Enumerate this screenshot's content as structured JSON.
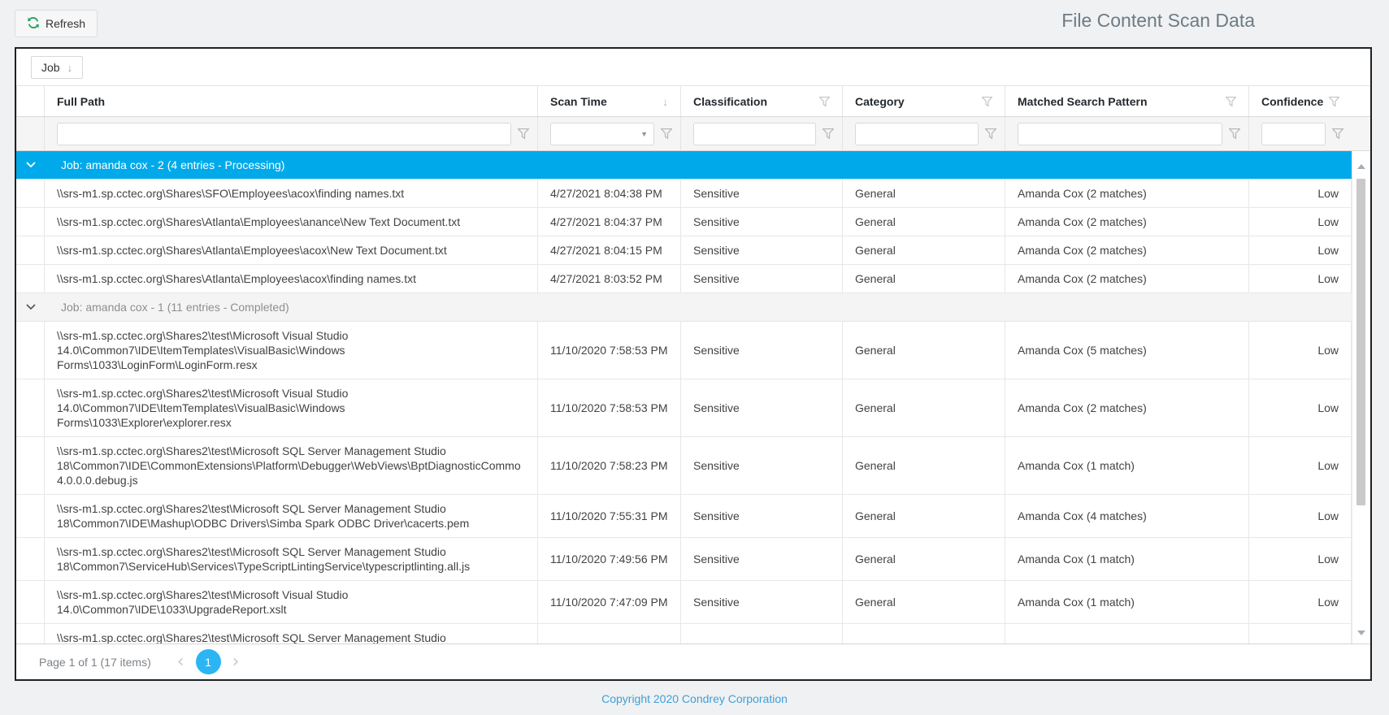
{
  "page": {
    "title": "File Content Scan Data",
    "footer_link": "Copyright 2020 Condrey Corporation"
  },
  "toolbar": {
    "refresh_label": "Refresh"
  },
  "group_panel": {
    "chip_label": "Job",
    "chip_sort_glyph": "↓"
  },
  "glyphs": {
    "sort_desc": "↓",
    "dropdown_caret": "▼",
    "prev": "‹",
    "next": "›"
  },
  "colors": {
    "selection_blue": "#00aaea",
    "pager_blue": "#2bb5f4",
    "refresh_green": "#27a163"
  },
  "columns": [
    {
      "label": "Full Path"
    },
    {
      "label": "Scan Time",
      "sort": "desc"
    },
    {
      "label": "Classification",
      "funnel": true
    },
    {
      "label": "Category",
      "funnel": true
    },
    {
      "label": "Matched Search Pattern",
      "funnel": true
    },
    {
      "label": "Confidence",
      "funnel": true
    }
  ],
  "filter_row": {
    "full_path_value": "",
    "scan_time_value": "",
    "classification_value": "",
    "category_value": "",
    "matched_value": "",
    "confidence_value": ""
  },
  "grid": {
    "groups": [
      {
        "label": "Job: amanda cox - 2 (4 entries - Processing)",
        "selected": true,
        "rows": [
          {
            "path_lines": [
              "\\\\srs-m1.sp.cctec.org\\Shares\\SFO\\Employees\\acox\\finding names.txt"
            ],
            "scan_time": "4/27/2021 8:04:38 PM",
            "classification": "Sensitive",
            "category": "General",
            "matched": "Amanda Cox (2 matches)",
            "confidence": "Low"
          },
          {
            "path_lines": [
              "\\\\srs-m1.sp.cctec.org\\Shares\\Atlanta\\Employees\\anance\\New Text Document.txt"
            ],
            "scan_time": "4/27/2021 8:04:37 PM",
            "classification": "Sensitive",
            "category": "General",
            "matched": "Amanda Cox (2 matches)",
            "confidence": "Low"
          },
          {
            "path_lines": [
              "\\\\srs-m1.sp.cctec.org\\Shares\\Atlanta\\Employees\\acox\\New Text Document.txt"
            ],
            "scan_time": "4/27/2021 8:04:15 PM",
            "classification": "Sensitive",
            "category": "General",
            "matched": "Amanda Cox (2 matches)",
            "confidence": "Low"
          },
          {
            "path_lines": [
              "\\\\srs-m1.sp.cctec.org\\Shares\\Atlanta\\Employees\\acox\\finding names.txt"
            ],
            "scan_time": "4/27/2021 8:03:52 PM",
            "classification": "Sensitive",
            "category": "General",
            "matched": "Amanda Cox (2 matches)",
            "confidence": "Low"
          }
        ]
      },
      {
        "label": "Job: amanda cox - 1 (11 entries - Completed)",
        "selected": false,
        "rows": [
          {
            "path_lines": [
              "\\\\srs-m1.sp.cctec.org\\Shares2\\test\\Microsoft Visual Studio",
              "14.0\\Common7\\IDE\\ItemTemplates\\VisualBasic\\Windows",
              "Forms\\1033\\LoginForm\\LoginForm.resx"
            ],
            "scan_time": "11/10/2020 7:58:53 PM",
            "classification": "Sensitive",
            "category": "General",
            "matched": "Amanda Cox (5 matches)",
            "confidence": "Low"
          },
          {
            "path_lines": [
              "\\\\srs-m1.sp.cctec.org\\Shares2\\test\\Microsoft Visual Studio",
              "14.0\\Common7\\IDE\\ItemTemplates\\VisualBasic\\Windows",
              "Forms\\1033\\Explorer\\explorer.resx"
            ],
            "scan_time": "11/10/2020 7:58:53 PM",
            "classification": "Sensitive",
            "category": "General",
            "matched": "Amanda Cox (2 matches)",
            "confidence": "Low"
          },
          {
            "path_lines": [
              "\\\\srs-m1.sp.cctec.org\\Shares2\\test\\Microsoft SQL Server Management Studio",
              "18\\Common7\\IDE\\CommonExtensions\\Platform\\Debugger\\WebViews\\BptDiagnosticCommo",
              "4.0.0.0.debug.js"
            ],
            "scan_time": "11/10/2020 7:58:23 PM",
            "classification": "Sensitive",
            "category": "General",
            "matched": "Amanda Cox (1 match)",
            "confidence": "Low"
          },
          {
            "path_lines": [
              "\\\\srs-m1.sp.cctec.org\\Shares2\\test\\Microsoft SQL Server Management Studio",
              "18\\Common7\\IDE\\Mashup\\ODBC Drivers\\Simba Spark ODBC Driver\\cacerts.pem"
            ],
            "scan_time": "11/10/2020 7:55:31 PM",
            "classification": "Sensitive",
            "category": "General",
            "matched": "Amanda Cox (4 matches)",
            "confidence": "Low"
          },
          {
            "path_lines": [
              "\\\\srs-m1.sp.cctec.org\\Shares2\\test\\Microsoft SQL Server Management Studio",
              "18\\Common7\\ServiceHub\\Services\\TypeScriptLintingService\\typescriptlinting.all.js"
            ],
            "scan_time": "11/10/2020 7:49:56 PM",
            "classification": "Sensitive",
            "category": "General",
            "matched": "Amanda Cox (1 match)",
            "confidence": "Low"
          },
          {
            "path_lines": [
              "\\\\srs-m1.sp.cctec.org\\Shares2\\test\\Microsoft Visual Studio",
              "14.0\\Common7\\IDE\\1033\\UpgradeReport.xslt"
            ],
            "scan_time": "11/10/2020 7:47:09 PM",
            "classification": "Sensitive",
            "category": "General",
            "matched": "Amanda Cox (1 match)",
            "confidence": "Low"
          },
          {
            "path_lines": [
              "\\\\srs-m1.sp.cctec.org\\Shares2\\test\\Microsoft SQL Server Management Studio"
            ],
            "scan_time": "",
            "classification": "",
            "category": "",
            "matched": "",
            "confidence": "",
            "clipped": true
          }
        ]
      }
    ]
  },
  "pager": {
    "summary": "Page 1 of 1 (17 items)",
    "current_page": "1"
  }
}
